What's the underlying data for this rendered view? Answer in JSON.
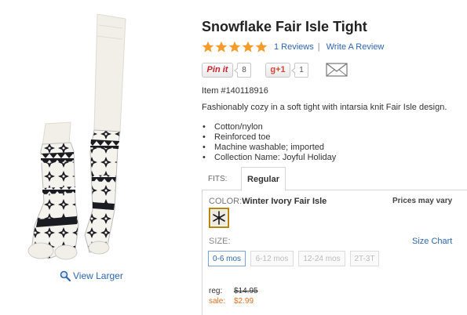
{
  "product": {
    "title": "Snowflake Fair Isle Tight",
    "rating_stars": 5,
    "reviews_link": "1 Reviews",
    "review_separator": "|",
    "write_review_link": "Write A Review",
    "item_number": "Item #140118916",
    "description": "Fashionably cozy in a soft tight with intarsia knit Fair Isle design.",
    "features": [
      "Cotton/nylon",
      "Reinforced toe",
      "Machine washable; imported",
      "Collection Name: Joyful Holiday"
    ],
    "view_larger": "View Larger"
  },
  "social": {
    "pinit_label": "Pin it",
    "pinit_count": "8",
    "gplus_label": "g+1",
    "gplus_count": "1"
  },
  "fits": {
    "label": "FITS:",
    "tabs": [
      {
        "label": "Regular",
        "selected": true
      }
    ]
  },
  "options": {
    "color_label": "COLOR:",
    "color_value": "Winter Ivory Fair Isle",
    "prices_note": "Prices may vary",
    "size_label": "SIZE:",
    "size_chart": "Size Chart",
    "sizes": [
      {
        "label": "0-6 mos",
        "selected": true
      },
      {
        "label": "6-12 mos",
        "selected": false
      },
      {
        "label": "12-24 mos",
        "selected": false
      },
      {
        "label": "2T-3T",
        "selected": false
      }
    ]
  },
  "pricing": {
    "reg_label": "reg:",
    "reg_value": "$14.95",
    "sale_label": "sale:",
    "sale_value": "$2.99"
  },
  "colors": {
    "link": "#2e66b0",
    "star": "#f39c2c",
    "sale": "#e07020",
    "swatch_border": "#b8860b"
  },
  "icons": {
    "magnifier": "magnifier-icon",
    "star": "star-icon",
    "email": "email-icon",
    "swatch": "snowflake-swatch-icon"
  }
}
